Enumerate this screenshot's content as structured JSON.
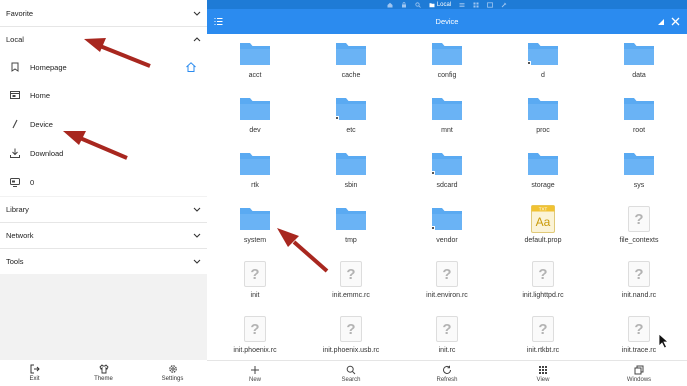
{
  "status_bar": {
    "location_label": "Local"
  },
  "toolbar": {
    "title": "Device"
  },
  "drawer": {
    "sections": {
      "favorite": "Favorite",
      "local": "Local",
      "library": "Library",
      "network": "Network",
      "tools": "Tools"
    },
    "items": [
      {
        "label": "Homepage",
        "icon": "homepage-icon"
      },
      {
        "label": "Home",
        "icon": "folder-home-icon"
      },
      {
        "label": "Device",
        "icon": "slash-icon"
      },
      {
        "label": "Download",
        "icon": "download-icon"
      },
      {
        "label": "0",
        "icon": "storage-icon"
      }
    ],
    "bottom": {
      "exit": "Exit",
      "theme": "Theme",
      "settings": "Settings"
    }
  },
  "files": [
    {
      "name": "acct",
      "type": "folder"
    },
    {
      "name": "cache",
      "type": "folder"
    },
    {
      "name": "config",
      "type": "folder"
    },
    {
      "name": "d",
      "type": "folder-link"
    },
    {
      "name": "data",
      "type": "folder"
    },
    {
      "name": "dev",
      "type": "folder"
    },
    {
      "name": "etc",
      "type": "folder-link"
    },
    {
      "name": "mnt",
      "type": "folder"
    },
    {
      "name": "proc",
      "type": "folder"
    },
    {
      "name": "root",
      "type": "folder"
    },
    {
      "name": "rtk",
      "type": "folder"
    },
    {
      "name": "sbin",
      "type": "folder"
    },
    {
      "name": "sdcard",
      "type": "folder-link"
    },
    {
      "name": "storage",
      "type": "folder"
    },
    {
      "name": "sys",
      "type": "folder"
    },
    {
      "name": "system",
      "type": "folder"
    },
    {
      "name": "tmp",
      "type": "folder"
    },
    {
      "name": "vendor",
      "type": "folder-link"
    },
    {
      "name": "default.prop",
      "type": "text-file",
      "badge": "TXT"
    },
    {
      "name": "file_contexts",
      "type": "unknown"
    },
    {
      "name": "init",
      "type": "unknown"
    },
    {
      "name": "init.emmc.rc",
      "type": "unknown"
    },
    {
      "name": "init.environ.rc",
      "type": "unknown"
    },
    {
      "name": "init.lighttpd.rc",
      "type": "unknown"
    },
    {
      "name": "init.nand.rc",
      "type": "unknown"
    },
    {
      "name": "init.phoenix.rc",
      "type": "unknown"
    },
    {
      "name": "init.phoenix.usb.rc",
      "type": "unknown"
    },
    {
      "name": "init.rc",
      "type": "unknown"
    },
    {
      "name": "init.rtkbt.rc",
      "type": "unknown"
    },
    {
      "name": "init.trace.rc",
      "type": "unknown"
    }
  ],
  "bottom_bar": {
    "new": "New",
    "search": "Search",
    "refresh": "Refresh",
    "view": "View",
    "windows": "Windows"
  },
  "colors": {
    "accent": "#2b8bef",
    "folder": "#5aaaf2",
    "arrow": "#b3261e"
  }
}
